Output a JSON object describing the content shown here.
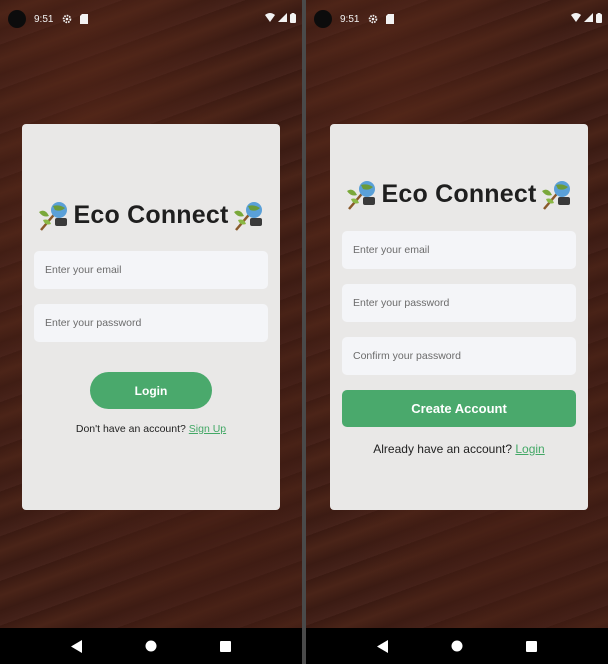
{
  "status_bar": {
    "time": "9:51"
  },
  "login_screen": {
    "brand_title": "Eco Connect",
    "email_placeholder": "Enter your email",
    "password_placeholder": "Enter your password",
    "login_button": "Login",
    "footer_prompt": "Don't have an account?",
    "footer_link": "Sign Up"
  },
  "signup_screen": {
    "brand_title": "Eco Connect",
    "email_placeholder": "Enter your email",
    "password_placeholder": "Enter your password",
    "confirm_placeholder": "Confirm your password",
    "create_button": "Create Account",
    "footer_prompt": "Already have an account?",
    "footer_link": "Login"
  },
  "colors": {
    "accent_green": "#4aa96c",
    "card_bg": "#e9e8e7",
    "background_brown": "#3e1d14"
  },
  "icons": [
    "settings-icon",
    "sd-card-icon",
    "wifi-icon",
    "signal-icon",
    "battery-icon",
    "back-icon",
    "home-icon",
    "recents-icon",
    "eco-emoji-icon"
  ]
}
